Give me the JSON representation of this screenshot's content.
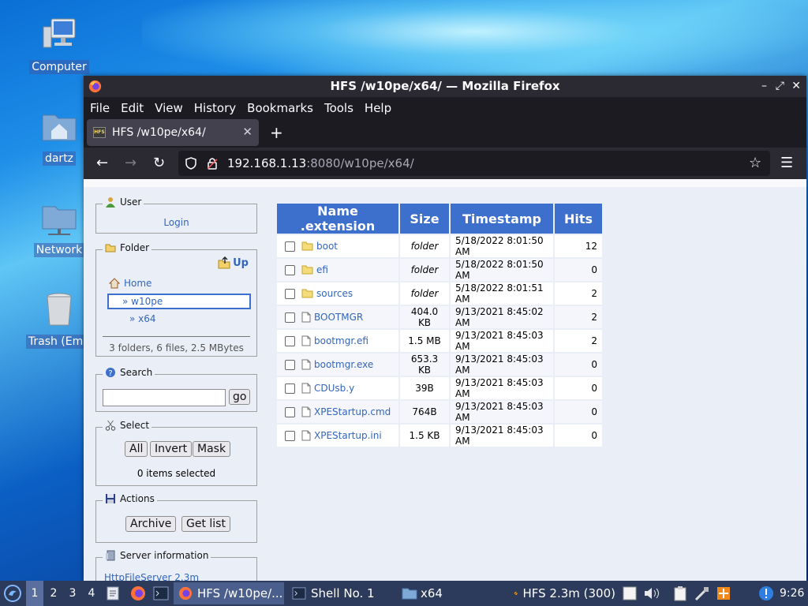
{
  "desktop": {
    "icons": [
      {
        "label": "Computer"
      },
      {
        "label": "dartz"
      },
      {
        "label": "Network"
      },
      {
        "label": "Trash (Emp"
      }
    ]
  },
  "window": {
    "title": "HFS /w10pe/x64/ — Mozilla Firefox",
    "controls": {
      "minimize": "–",
      "maximize": "⤢",
      "close": "✕"
    }
  },
  "menu": [
    "File",
    "Edit",
    "View",
    "History",
    "Bookmarks",
    "Tools",
    "Help"
  ],
  "tab": {
    "label": "HFS /w10pe/x64/",
    "favicon_text": "HFS",
    "close": "✕",
    "new": "+"
  },
  "nav": {
    "back": "←",
    "forward": "→",
    "reload": "↻",
    "url_host": "192.168.1.13",
    "url_rest": ":8080/w10pe/x64/",
    "bookmark": "☆",
    "menu": "☰"
  },
  "hfs": {
    "user": {
      "title": "User",
      "login": "Login"
    },
    "folder": {
      "title": "Folder",
      "up": "Up",
      "home": "Home",
      "path1": "» w10pe",
      "path2": "» x64",
      "summary": "3 folders, 6 files, 2.5 MBytes"
    },
    "search": {
      "title": "Search",
      "go": "go",
      "value": ""
    },
    "select": {
      "title": "Select",
      "all": "All",
      "invert": "Invert",
      "mask": "Mask",
      "status": "0 items selected"
    },
    "actions": {
      "title": "Actions",
      "archive": "Archive",
      "getlist": "Get list"
    },
    "server": {
      "title": "Server information",
      "version": "HttpFileServer 2.3m"
    },
    "table": {
      "headers": [
        "Name .extension",
        "Size",
        "Timestamp",
        "Hits"
      ],
      "rows": [
        {
          "name": "boot",
          "size": "folder",
          "ts": "5/18/2022 8:01:50 AM",
          "hits": "12",
          "type": "folder"
        },
        {
          "name": "efi",
          "size": "folder",
          "ts": "5/18/2022 8:01:50 AM",
          "hits": "0",
          "type": "folder"
        },
        {
          "name": "sources",
          "size": "folder",
          "ts": "5/18/2022 8:01:51 AM",
          "hits": "2",
          "type": "folder"
        },
        {
          "name": "BOOTMGR",
          "size": "404.0 KB",
          "ts": "9/13/2021 8:45:02 AM",
          "hits": "2",
          "type": "file"
        },
        {
          "name": "bootmgr.efi",
          "size": "1.5 MB",
          "ts": "9/13/2021 8:45:03 AM",
          "hits": "2",
          "type": "file"
        },
        {
          "name": "bootmgr.exe",
          "size": "653.3 KB",
          "ts": "9/13/2021 8:45:03 AM",
          "hits": "0",
          "type": "file"
        },
        {
          "name": "CDUsb.y",
          "size": "39B",
          "ts": "9/13/2021 8:45:03 AM",
          "hits": "0",
          "type": "file"
        },
        {
          "name": "XPEStartup.cmd",
          "size": "764B",
          "ts": "9/13/2021 8:45:03 AM",
          "hits": "0",
          "type": "file"
        },
        {
          "name": "XPEStartup.ini",
          "size": "1.5 KB",
          "ts": "9/13/2021 8:45:03 AM",
          "hits": "0",
          "type": "file"
        }
      ]
    }
  },
  "taskbar": {
    "workspaces": [
      "1",
      "2",
      "3",
      "4"
    ],
    "tasks": [
      {
        "label": "HFS /w10pe/..."
      },
      {
        "label": "Shell No. 1"
      },
      {
        "label": "x64"
      }
    ],
    "tray_app": "HFS 2.3m (300)",
    "clock": "9:26"
  },
  "colors": {
    "header_blue": "#3d6fcc",
    "link": "#3366bb",
    "firefox_dark": "#2b2a33"
  }
}
